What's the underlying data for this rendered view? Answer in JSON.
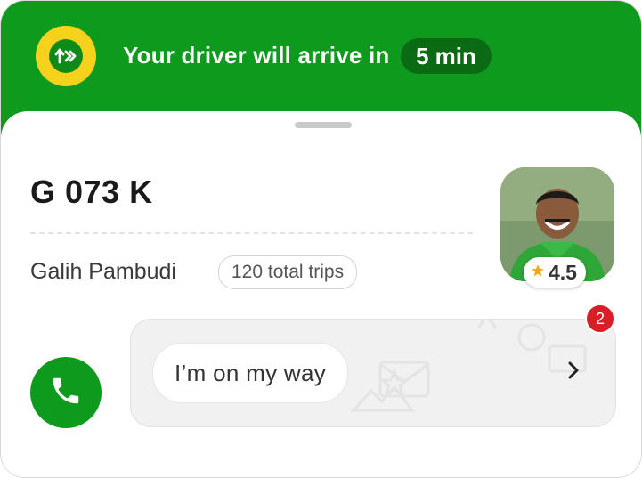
{
  "banner": {
    "message": "Your driver will arrive in",
    "eta": "5 min",
    "icon": "route-arrows-icon",
    "color": "#0e9a1c",
    "icon_bg": "#f7d21c"
  },
  "driver": {
    "plate": "G 073 K",
    "name": "Galih Pambudi",
    "trips": "120 total trips",
    "rating": "4.5"
  },
  "chat": {
    "message": "I’m on my way",
    "unread": "2"
  },
  "colors": {
    "accent": "#0e9a1c",
    "badge": "#d81f26",
    "star": "#f2a614"
  }
}
